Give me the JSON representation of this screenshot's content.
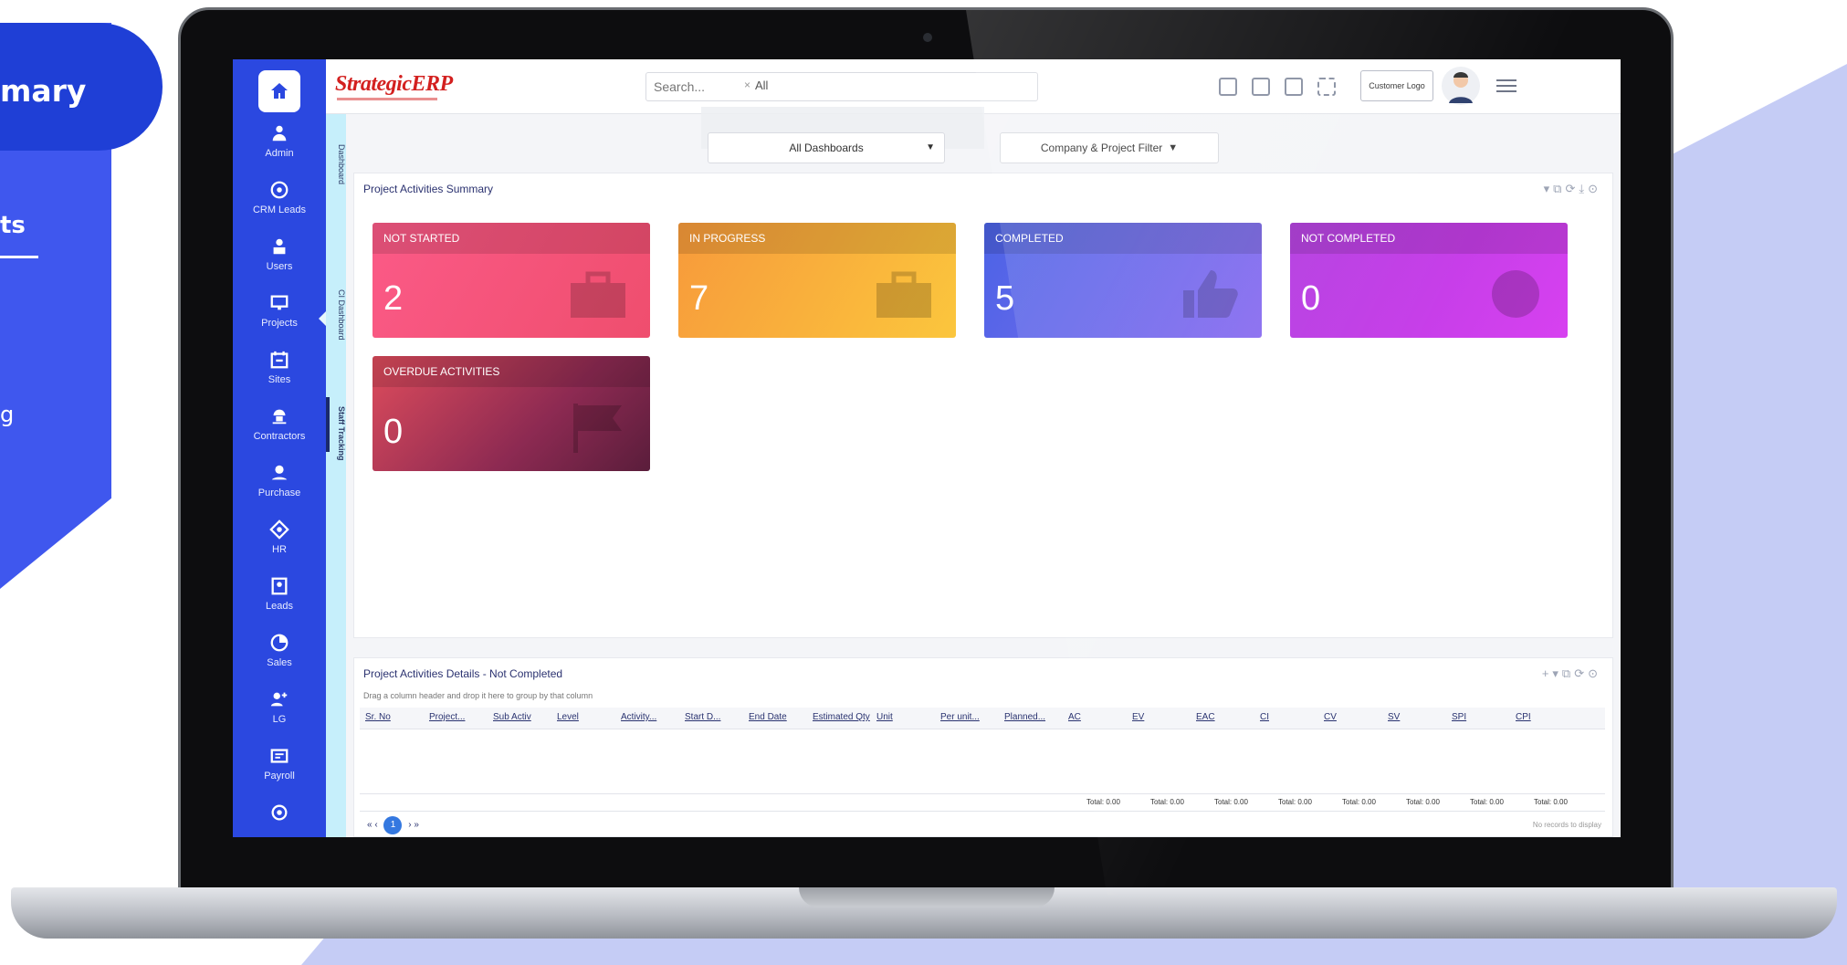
{
  "side_panel": {
    "pill_label": "mary",
    "tab_label": "ts",
    "item_label": "g"
  },
  "app": {
    "logo": "StrategicERP",
    "search": {
      "placeholder": "Search...",
      "scope": "All",
      "clear": "×"
    },
    "customer_logo": "Customer Logo",
    "dashboard_select": "All Dashboards",
    "company_filter": "Company & Project Filter"
  },
  "sidebar": {
    "items": [
      {
        "label": "Admin",
        "icon": "admin-icon"
      },
      {
        "label": "CRM Leads",
        "icon": "crm-icon"
      },
      {
        "label": "Users",
        "icon": "users-icon"
      },
      {
        "label": "Projects",
        "icon": "projects-icon"
      },
      {
        "label": "Sites",
        "icon": "sites-icon"
      },
      {
        "label": "Contractors",
        "icon": "contractors-icon"
      },
      {
        "label": "Purchase",
        "icon": "purchase-icon"
      },
      {
        "label": "HR",
        "icon": "hr-icon"
      },
      {
        "label": "Leads",
        "icon": "leads-icon"
      },
      {
        "label": "Sales",
        "icon": "sales-icon"
      },
      {
        "label": "LG",
        "icon": "lg-icon"
      },
      {
        "label": "Payroll",
        "icon": "payroll-icon"
      }
    ]
  },
  "vtabs": [
    "Dashboard",
    "CI Dashboard",
    "Staff Tracking"
  ],
  "summary_panel": {
    "title": "Project Activities Summary",
    "tiles": [
      {
        "label": "NOT STARTED",
        "value": "2"
      },
      {
        "label": "IN PROGRESS",
        "value": "7"
      },
      {
        "label": "COMPLETED",
        "value": "5"
      },
      {
        "label": "NOT COMPLETED",
        "value": "0"
      },
      {
        "label": "OVERDUE ACTIVITIES",
        "value": "0"
      }
    ]
  },
  "details_panel": {
    "title": "Project Activities Details - Not Completed",
    "group_hint": "Drag a column header and drop it here to group by that column",
    "columns": [
      "Sr. No",
      "Project...",
      "Sub Activ",
      "Level",
      "Activity...",
      "Start D...",
      "End Date",
      "Estimated Qty",
      "Unit",
      "Per unit...",
      "Planned...",
      "AC",
      "EV",
      "EAC",
      "CI",
      "CV",
      "SV",
      "SPI",
      "CPI"
    ],
    "totals": [
      "Total: 0.00",
      "Total: 0.00",
      "Total: 0.00",
      "Total: 0.00",
      "Total: 0.00",
      "Total: 0.00",
      "Total: 0.00",
      "Total: 0.00"
    ],
    "pager": {
      "first": "«",
      "prev": "‹",
      "page": "1",
      "next": "›",
      "last": "»"
    },
    "no_records": "No records to display"
  }
}
